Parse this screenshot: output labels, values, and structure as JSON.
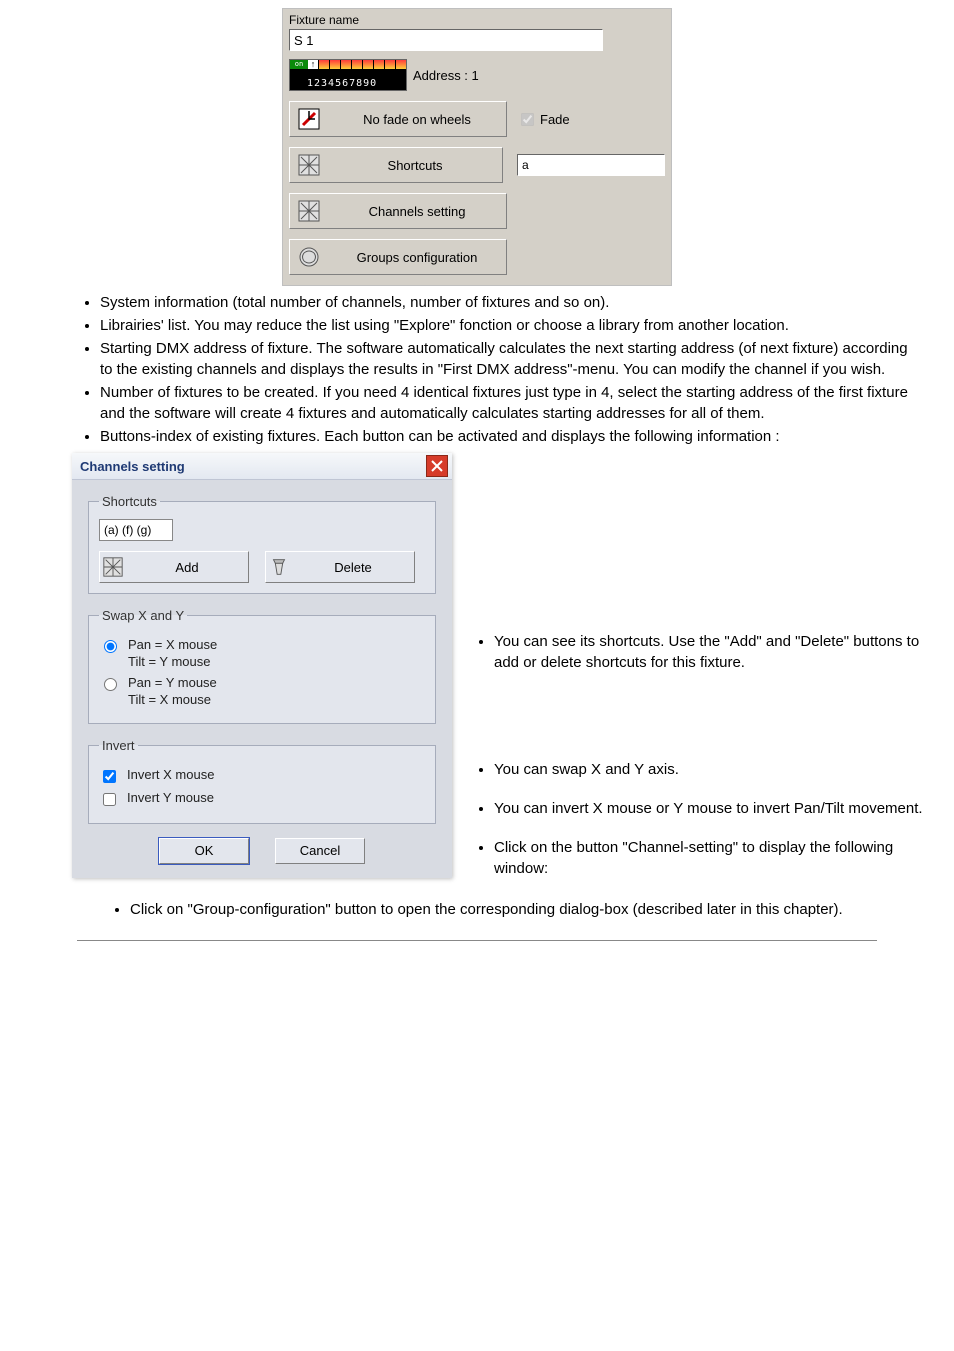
{
  "fixture_panel": {
    "label": "Fixture name",
    "name_value": "S 1",
    "dip_numbers": "1234567890",
    "dip_on": "on",
    "address_label": "Address : 1",
    "buttons": {
      "no_fade": "No fade on wheels",
      "shortcuts": "Shortcuts",
      "channels": "Channels setting",
      "groups": "Groups configuration"
    },
    "fade_checkbox": "Fade",
    "shortcut_value": "a"
  },
  "text_list_top": [
    "System information (total number of channels, number of fixtures and so on).",
    "Librairies' list. You may reduce the list using \"Explore\" fonction or choose a library from another location.",
    "Starting DMX address of fixture. The software automatically calculates the next starting address (of next fixture) according to the existing channels and displays the results in \"First DMX address\"-menu. You can modify the channel if you wish.",
    "Number of fixtures to be created. If you need 4 identical fixtures just type in 4, select the starting address of the first fixture and the software will create 4 fixtures and automatically calculates starting addresses for all of them.",
    "Buttons-index of existing fixtures. Each button can be activated and displays the following information :"
  ],
  "side_list": [
    "You can see its shortcuts. Use the \"Add\" and \"Delete\" buttons to add or delete shortcuts for this fixture.",
    "You can swap X and Y axis.",
    "You can invert X mouse or Y mouse to invert Pan/Tilt movement.",
    "Click on the button \"Channel-setting\" to display the following window:"
  ],
  "bottom_list": [
    "Click on \"Group-configuration\" button to open the corresponding dialog-box (described later in this chapter)."
  ],
  "channels_dialog": {
    "title": "Channels setting",
    "shortcuts_legend": "Shortcuts",
    "shortcuts_value": "(a) (f) (g)",
    "add": "Add",
    "delete": "Delete",
    "swap_legend": "Swap X and Y",
    "radio1a": "Pan = X mouse",
    "radio1b": "Tilt = Y mouse",
    "radio2a": "Pan = Y mouse",
    "radio2b": "Tilt = X mouse",
    "invert_legend": "Invert",
    "invert_x": "Invert X mouse",
    "invert_y": "Invert Y mouse",
    "ok": "OK",
    "cancel": "Cancel"
  }
}
